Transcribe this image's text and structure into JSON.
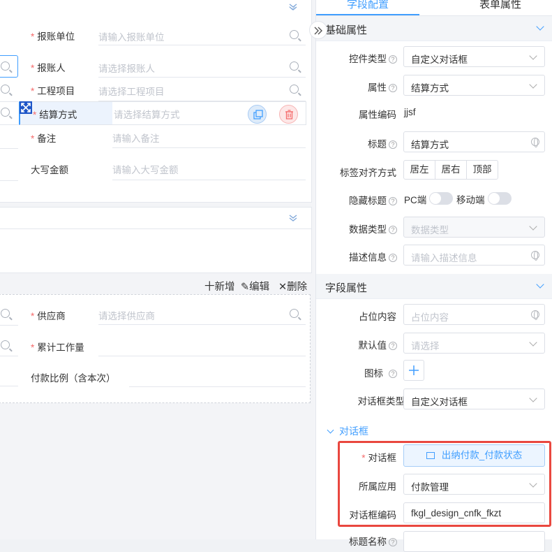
{
  "form": {
    "fields": [
      {
        "label": "报账单位",
        "required": true,
        "placeholder": "请输入报账单位"
      },
      {
        "label": "报账人",
        "required": true,
        "placeholder": "请选择报账人"
      },
      {
        "label": "工程项目",
        "required": true,
        "placeholder": "请选择工程项目"
      },
      {
        "label": "结算方式",
        "required": true,
        "placeholder": "请选择结算方式"
      },
      {
        "label": "备注",
        "required": true,
        "placeholder": "请输入备注"
      },
      {
        "label": "大写金额",
        "required": false,
        "placeholder": "请输入大写金额"
      }
    ],
    "required_mark": "*"
  },
  "subtable": {
    "actions": {
      "add": "十新增",
      "edit": "编辑",
      "delete": "删除"
    },
    "fields": [
      {
        "label": "供应商",
        "required": true,
        "placeholder": "请选择供应商"
      },
      {
        "label": "累计工作量",
        "required": true,
        "placeholder": ""
      },
      {
        "label": "付款比例（含本次）",
        "required": false,
        "placeholder": ""
      }
    ]
  },
  "panel": {
    "tabs": [
      "字段配置",
      "表单属性"
    ],
    "basic_section": "基础属性",
    "basic": {
      "control_type_label": "控件类型",
      "control_type_value": "自定义对话框",
      "attr_label": "属性",
      "attr_value": "结算方式",
      "attr_code_label": "属性编码",
      "attr_code_value": "jjsf",
      "title_label": "标题",
      "title_value": "结算方式",
      "align_label": "标签对齐方式",
      "align_options": [
        "居左",
        "居右",
        "顶部"
      ],
      "hide_title_label": "隐藏标题",
      "pc_label": "PC端",
      "mobile_label": "移动端",
      "data_type_label": "数据类型",
      "data_type_placeholder": "数据类型",
      "desc_label": "描述信息",
      "desc_placeholder": "请输入描述信息"
    },
    "field_section": "字段属性",
    "field": {
      "placeholder_label": "占位内容",
      "placeholder_placeholder": "占位内容",
      "default_label": "默认值",
      "default_placeholder": "请选择",
      "icon_label": "图标",
      "dialog_type_label": "对话框类型",
      "dialog_type_value": "自定义对话框"
    },
    "dialog_section": "对话框",
    "dialog": {
      "dialog_label": "对话框",
      "dialog_value": "出纳付款_付款状态",
      "app_label": "所属应用",
      "app_value": "付款管理",
      "code_label": "对话框编码",
      "code_value": "fkgl_design_cnfk_fkzt",
      "next_label": "标题名称"
    }
  },
  "colors": {
    "accent": "#409eff",
    "required": "#f56c6c",
    "highlight": "#e9473f"
  }
}
